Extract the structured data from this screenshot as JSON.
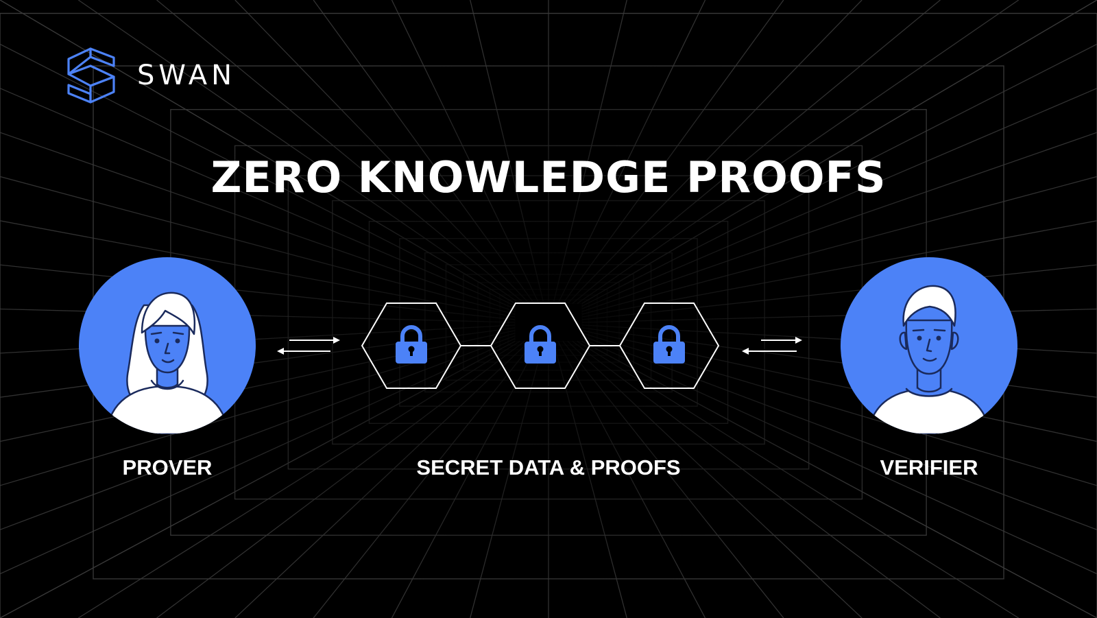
{
  "brand": {
    "name": "SWAN",
    "logo_icon": "swan-logo-icon",
    "accent_color": "#4C82F7"
  },
  "title": "ZERO KNOWLEDGE PROOFS",
  "nodes": {
    "prover": {
      "label": "PROVER",
      "icon": "woman-avatar-icon"
    },
    "secret": {
      "label": "SECRET DATA & PROOFS",
      "icon": "lock-icon",
      "block_count": 3
    },
    "verifier": {
      "label": "VERIFIER",
      "icon": "man-avatar-icon"
    }
  },
  "connectors": {
    "left": "bidirectional-arrows-icon",
    "right": "bidirectional-arrows-icon"
  },
  "colors": {
    "background": "#000000",
    "grid_line": "#3a3a3a",
    "text": "#ffffff",
    "accent": "#4C82F7"
  }
}
